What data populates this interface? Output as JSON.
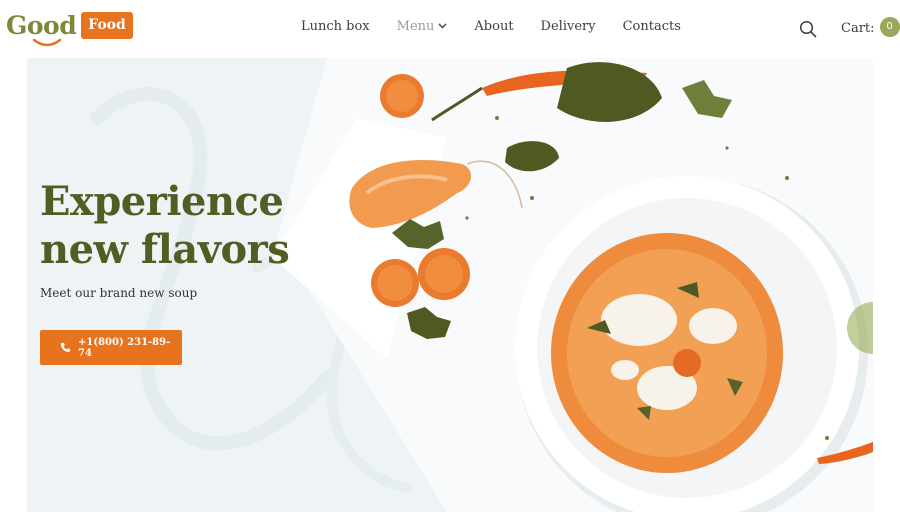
{
  "brand": {
    "name_primary": "Good",
    "name_badge": "Food",
    "accent_green": "#7a8a3a",
    "accent_orange": "#e8731e"
  },
  "nav": {
    "items": [
      {
        "label": "Lunch box"
      },
      {
        "label": "Menu"
      },
      {
        "label": "About"
      },
      {
        "label": "Delivery"
      },
      {
        "label": "Contacts"
      }
    ]
  },
  "header": {
    "search_icon": "search-icon",
    "cart_label": "Cart:",
    "cart_count": "0"
  },
  "hero": {
    "title_line1": "Experience",
    "title_line2": "new flavors",
    "subtitle": "Meet our brand new soup",
    "cta_icon": "phone-icon",
    "cta_label": "+1(800) 231-89-74",
    "title_color": "#535d23",
    "background": "#eef4f6"
  }
}
